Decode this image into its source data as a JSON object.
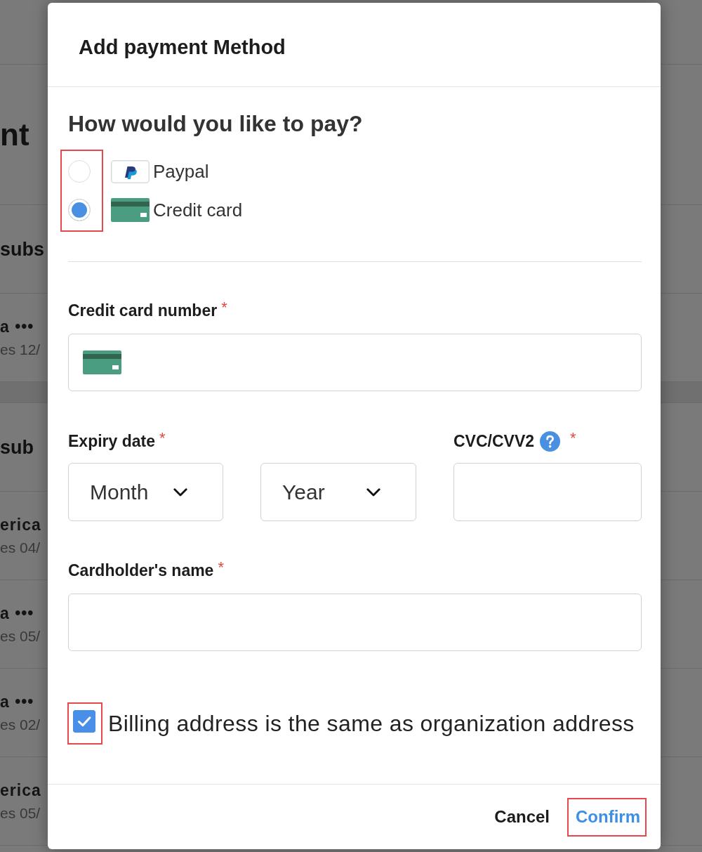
{
  "background_page": {
    "heading": "nt",
    "sections": [
      {
        "title": "subs",
        "cards": [
          {
            "name": "a •••",
            "expiry": "es 12/"
          }
        ]
      },
      {
        "title": "sub",
        "cards": [
          {
            "name": "erica",
            "expiry": "es 04/"
          },
          {
            "name": "a •••",
            "expiry": "es 05/"
          },
          {
            "name": "a •••",
            "expiry": "es 02/"
          },
          {
            "name": "erica",
            "expiry": "es 05/"
          }
        ]
      }
    ]
  },
  "dialog": {
    "title": "Add payment Method"
  },
  "payment": {
    "question": "How would you like to pay?",
    "highlighted": true,
    "options": [
      {
        "kind": "paypal",
        "label": "Paypal",
        "selected": false
      },
      {
        "kind": "card",
        "label": "Credit card",
        "selected": true
      }
    ]
  },
  "card_number": {
    "label": "Credit card number",
    "required_mark": "*"
  },
  "expiry": {
    "label": "Expiry date",
    "required_mark": "*",
    "selects": [
      {
        "value": "Month"
      },
      {
        "value": "Year"
      }
    ]
  },
  "cvc": {
    "label": "CVC/CVV2",
    "required_mark": "*",
    "help": true
  },
  "cardholder": {
    "label": "Cardholder's name",
    "required_mark": "*"
  },
  "billing": {
    "label": "Billing address is the same as organization address",
    "checked": true,
    "highlighted": true
  },
  "buttons": [
    {
      "kind": "cancel",
      "label": "Cancel",
      "highlighted": false
    },
    {
      "kind": "confirm",
      "label": "Confirm",
      "highlighted": true
    }
  ]
}
